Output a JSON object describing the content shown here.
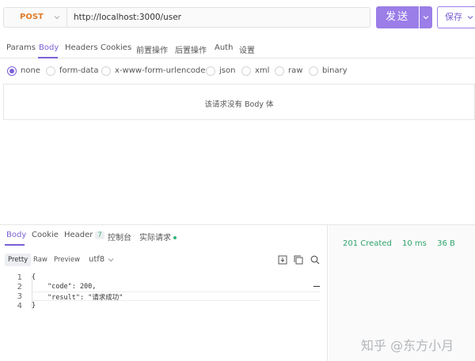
{
  "request": {
    "method": "POST",
    "url": "http://localhost:3000/user",
    "send_label": "发送",
    "save_label": "保存"
  },
  "tabs": [
    {
      "label": "Params",
      "active": false
    },
    {
      "label": "Body",
      "active": true
    },
    {
      "label": "Headers",
      "active": false
    },
    {
      "label": "Cookies",
      "active": false
    },
    {
      "label": "前置操作",
      "active": false
    },
    {
      "label": "后置操作",
      "active": false
    },
    {
      "label": "Auth",
      "active": false
    },
    {
      "label": "设置",
      "active": false
    }
  ],
  "body_types": [
    {
      "label": "none",
      "checked": true
    },
    {
      "label": "form-data",
      "checked": false
    },
    {
      "label": "x-www-form-urlencoded",
      "checked": false
    },
    {
      "label": "json",
      "checked": false
    },
    {
      "label": "xml",
      "checked": false
    },
    {
      "label": "raw",
      "checked": false
    },
    {
      "label": "binary",
      "checked": false
    }
  ],
  "empty_body_text": "该请求没有 Body 体",
  "response": {
    "tabs": [
      {
        "label": "Body",
        "active": true
      },
      {
        "label": "Cookie",
        "active": false
      },
      {
        "label": "Header",
        "active": false,
        "badge": "7"
      },
      {
        "label": "控制台",
        "active": false
      },
      {
        "label": "实际请求",
        "active": false,
        "dot": true
      }
    ],
    "formats": [
      {
        "label": "Pretty",
        "active": true
      },
      {
        "label": "Raw",
        "active": false
      },
      {
        "label": "Preview",
        "active": false
      }
    ],
    "encoding": "utf8",
    "code_lines": [
      "{",
      "\"code\": 200,",
      "\"result\": \"请求成功\"",
      "}"
    ],
    "line_numbers": [
      "1",
      "2",
      "3",
      "4"
    ],
    "status": "201 Created",
    "time": "10 ms",
    "size": "36 B"
  },
  "watermark": "知乎 @东方小月",
  "colors": {
    "accent": "#9b7ee8",
    "method": "#e07c2b",
    "status_ok": "#2fa36b"
  }
}
